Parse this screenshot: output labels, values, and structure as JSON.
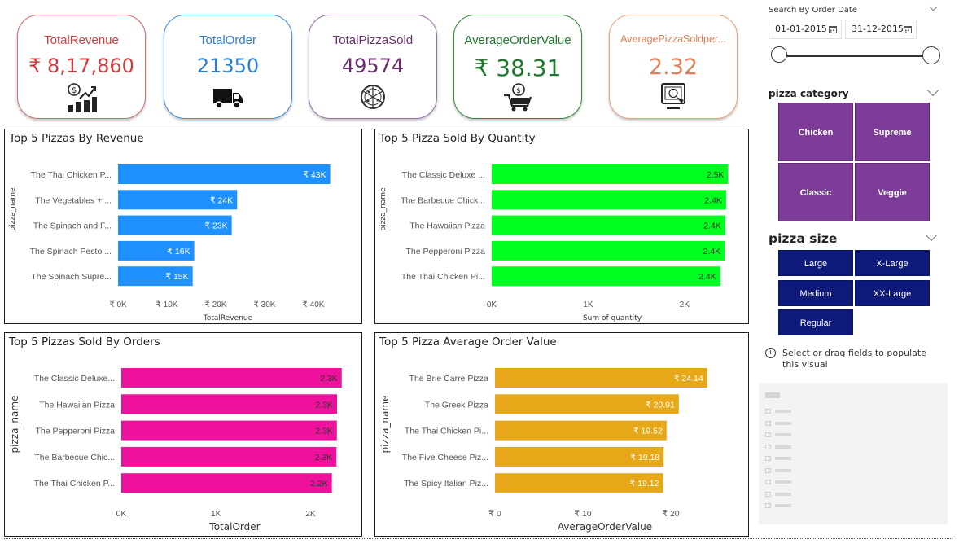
{
  "kpis": [
    {
      "title": "TotalRevenue",
      "value": "₹ 8,17,860",
      "title_color": "#d23b3b",
      "value_color": "#d23b3b",
      "border_color": "#d66b6b",
      "icon": "revenue-growth-icon"
    },
    {
      "title": "TotalOrder",
      "value": "21350",
      "title_color": "#2a7fd4",
      "value_color": "#2a7fd4",
      "border_color": "#3a8fe0",
      "icon": "delivery-truck-icon"
    },
    {
      "title": "TotalPizzaSold",
      "value": "49574",
      "title_color": "#6a2c70",
      "value_color": "#6a2c70",
      "border_color": "#9a6fa8",
      "icon": "pizza-icon"
    },
    {
      "title": "AverageOrderValue",
      "value": "₹ 38.31",
      "title_color": "#1e7a2c",
      "value_color": "#1e7a2c",
      "border_color": "#2e8b3c",
      "icon": "shopping-cart-coin-icon"
    },
    {
      "title": "AveragePizzaSoldper...",
      "value": "2.32",
      "title_color": "#e07e58",
      "value_color": "#e07e58",
      "border_color": "#f0a080",
      "icon": "online-order-icon"
    }
  ],
  "chart_data": [
    {
      "type": "bar",
      "orientation": "horizontal",
      "title": "Top 5 Pizzas By Revenue",
      "xlabel": "TotalRevenue",
      "ylabel": "pizza_name",
      "color": "#1e90ff",
      "categories": [
        "The Thai Chicken P...",
        "The Vegetables + ...",
        "The Spinach and F...",
        "The Spinach Pesto ...",
        "The Spinach Supre..."
      ],
      "values": [
        43434,
        24374,
        23271,
        15597,
        15278
      ],
      "data_labels": [
        "₹ 43K",
        "₹ 24K",
        "₹ 23K",
        "₹ 16K",
        "₹ 15K"
      ],
      "xlim": [
        0,
        45000
      ],
      "xticks": [
        0,
        10000,
        20000,
        30000,
        40000
      ],
      "xtick_labels": [
        "₹ 0K",
        "₹ 10K",
        "₹ 20K",
        "₹ 30K",
        "₹ 40K"
      ]
    },
    {
      "type": "bar",
      "orientation": "horizontal",
      "title": "Top 5 Pizza Sold By Quantity",
      "xlabel": "Sum of quantity",
      "ylabel": "pizza_name",
      "color": "#00ff1e",
      "categories": [
        "The Classic Deluxe ...",
        "The Barbecue Chick...",
        "The Hawaiian Pizza",
        "The Pepperoni Pizza",
        "The Thai Chicken Pi..."
      ],
      "values": [
        2453,
        2432,
        2422,
        2418,
        2371
      ],
      "data_labels": [
        "2.5K",
        "2.4K",
        "2.4K",
        "2.4K",
        "2.4K"
      ],
      "xlim": [
        0,
        2500
      ],
      "xticks": [
        0,
        1000,
        2000
      ],
      "xtick_labels": [
        "0K",
        "1K",
        "2K"
      ]
    },
    {
      "type": "bar",
      "orientation": "horizontal",
      "title": "Top 5 Pizzas Sold By Orders",
      "xlabel": "TotalOrder",
      "ylabel": "pizza_name",
      "color": "#ee119b",
      "categories": [
        "The Classic Deluxe...",
        "The Hawaiian Pizza",
        "The Pepperoni Pizza",
        "The Barbecue Chic...",
        "The Thai Chicken P..."
      ],
      "values": [
        2329,
        2280,
        2278,
        2273,
        2225
      ],
      "data_labels": [
        "2.3K",
        "2.3K",
        "2.3K",
        "2.3K",
        "2.2K"
      ],
      "xlim": [
        0,
        2400
      ],
      "xticks": [
        0,
        1000,
        2000
      ],
      "xtick_labels": [
        "0K",
        "1K",
        "2K"
      ]
    },
    {
      "type": "bar",
      "orientation": "horizontal",
      "title": "Top 5 Pizza Average Order Value",
      "xlabel": "AverageOrderValue",
      "ylabel": "pizza_name",
      "color": "#e6a819",
      "categories": [
        "The Brie Carre Pizza",
        "The Greek Pizza",
        "The Thai Chicken Pi...",
        "The Five Cheese Piz...",
        "The Spicy Italian Piz..."
      ],
      "values": [
        24.14,
        20.91,
        19.52,
        19.18,
        19.12
      ],
      "data_labels": [
        "₹ 24.14",
        "₹ 20.91",
        "₹ 19.52",
        "₹ 19.18",
        "₹ 19.12"
      ],
      "xlim": [
        0,
        25
      ],
      "xticks": [
        0,
        10,
        20
      ],
      "xtick_labels": [
        "₹ 0",
        "₹ 10",
        "₹ 20"
      ]
    }
  ],
  "date_filter": {
    "label": "Search By Order Date",
    "start": "01-01-2015",
    "end": "31-12-2015"
  },
  "category_filter": {
    "label": "pizza category",
    "items": [
      "Chicken",
      "Supreme",
      "Classic",
      "Veggie"
    ]
  },
  "size_filter": {
    "label": "pizza size",
    "items": [
      "Large",
      "X-Large",
      "Medium",
      "XX-Large",
      "Regular"
    ]
  },
  "empty_visual": {
    "message": "Select or drag fields to populate this visual"
  }
}
